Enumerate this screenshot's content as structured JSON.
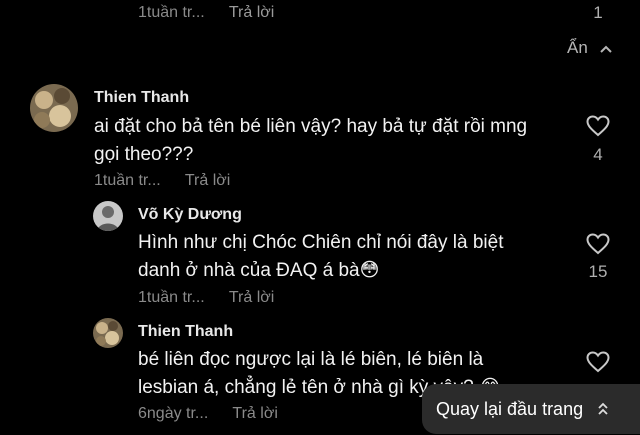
{
  "top_reply": {
    "time": "1tuần tr...",
    "reply_label": "Trả lời",
    "likes": "1"
  },
  "hide_label": "Ẩn",
  "comments": [
    {
      "name": "Thien Thanh",
      "text_lines": [
        "ai đặt cho bả tên bé liên vậy? hay bả tự đặt rồi mng",
        "gọi theo???"
      ],
      "time": "1tuần tr...",
      "reply_label": "Trả lời",
      "likes": "4"
    },
    {
      "name": "Võ Kỳ Dương",
      "text_lines": [
        "Hình như chị Chóc Chiên chỉ nói đây là biệt",
        "danh ở nhà của ĐAQ á bà😳"
      ],
      "time": "1tuần tr...",
      "reply_label": "Trả lời",
      "likes": "15"
    },
    {
      "name": "Thien Thanh",
      "text_lines": [
        "bé liên đọc ngược lại là lé biên, lé biên là",
        "lesbian á, chẳng lẻ tên ở nhà gì kỳ vậy? 😂"
      ],
      "time": "6ngày tr...",
      "reply_label": "Trả lời",
      "likes": ""
    }
  ],
  "back_to_top": {
    "label": "Quay lại đầu trang",
    "icon": "double-chevron-up-icon"
  }
}
